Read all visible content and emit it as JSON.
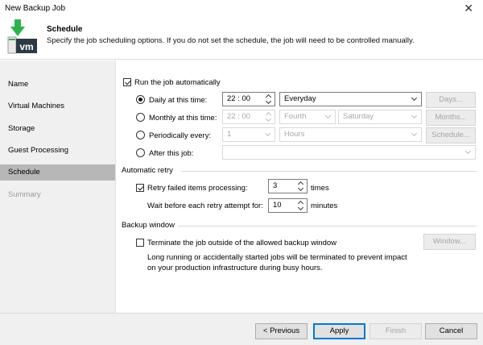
{
  "window": {
    "title": "New Backup Job",
    "close_glyph": "✕"
  },
  "header": {
    "title": "Schedule",
    "description": "Specify the job scheduling options. If you do not set the schedule, the job will need to be controlled manually.",
    "icon": "backup-job-vm-icon",
    "icon_text": "vm"
  },
  "sidebar": {
    "items": [
      {
        "label": "Name",
        "state": "normal"
      },
      {
        "label": "Virtual Machines",
        "state": "normal"
      },
      {
        "label": "Storage",
        "state": "normal"
      },
      {
        "label": "Guest Processing",
        "state": "normal"
      },
      {
        "label": "Schedule",
        "state": "active"
      },
      {
        "label": "Summary",
        "state": "disabled"
      }
    ]
  },
  "schedule": {
    "run_automatically_label": "Run the job automatically",
    "run_automatically_checked": true,
    "daily": {
      "label": "Daily at this time:",
      "time": "22 : 00",
      "frequency": "Everyday",
      "button": "Days..."
    },
    "monthly": {
      "label": "Monthly at this time:",
      "time": "22 : 00",
      "week": "Fourth",
      "day": "Saturday",
      "button": "Months..."
    },
    "periodically": {
      "label": "Periodically every:",
      "value": "1",
      "unit": "Hours",
      "button": "Schedule..."
    },
    "after": {
      "label": "After this job:",
      "value": ""
    }
  },
  "retry": {
    "section_title": "Automatic retry",
    "retry_label": "Retry failed items processing:",
    "retry_checked": true,
    "retry_count": "3",
    "retry_unit": "times",
    "wait_label": "Wait before each retry attempt for:",
    "wait_value": "10",
    "wait_unit": "minutes"
  },
  "backup_window": {
    "section_title": "Backup window",
    "terminate_label": "Terminate the job outside of the allowed backup window",
    "terminate_checked": false,
    "button": "Window...",
    "note_line1": "Long running or accidentally started jobs will be terminated to prevent impact",
    "note_line2": "on your production infrastructure during busy hours."
  },
  "footer": {
    "previous": "< Previous",
    "apply": "Apply",
    "finish": "Finish",
    "cancel": "Cancel"
  },
  "colors": {
    "accent": "#0078d7",
    "veeam_green": "#2db34a",
    "veeam_dark": "#2b3a44",
    "sidebar_active": "#b7b7b7"
  }
}
